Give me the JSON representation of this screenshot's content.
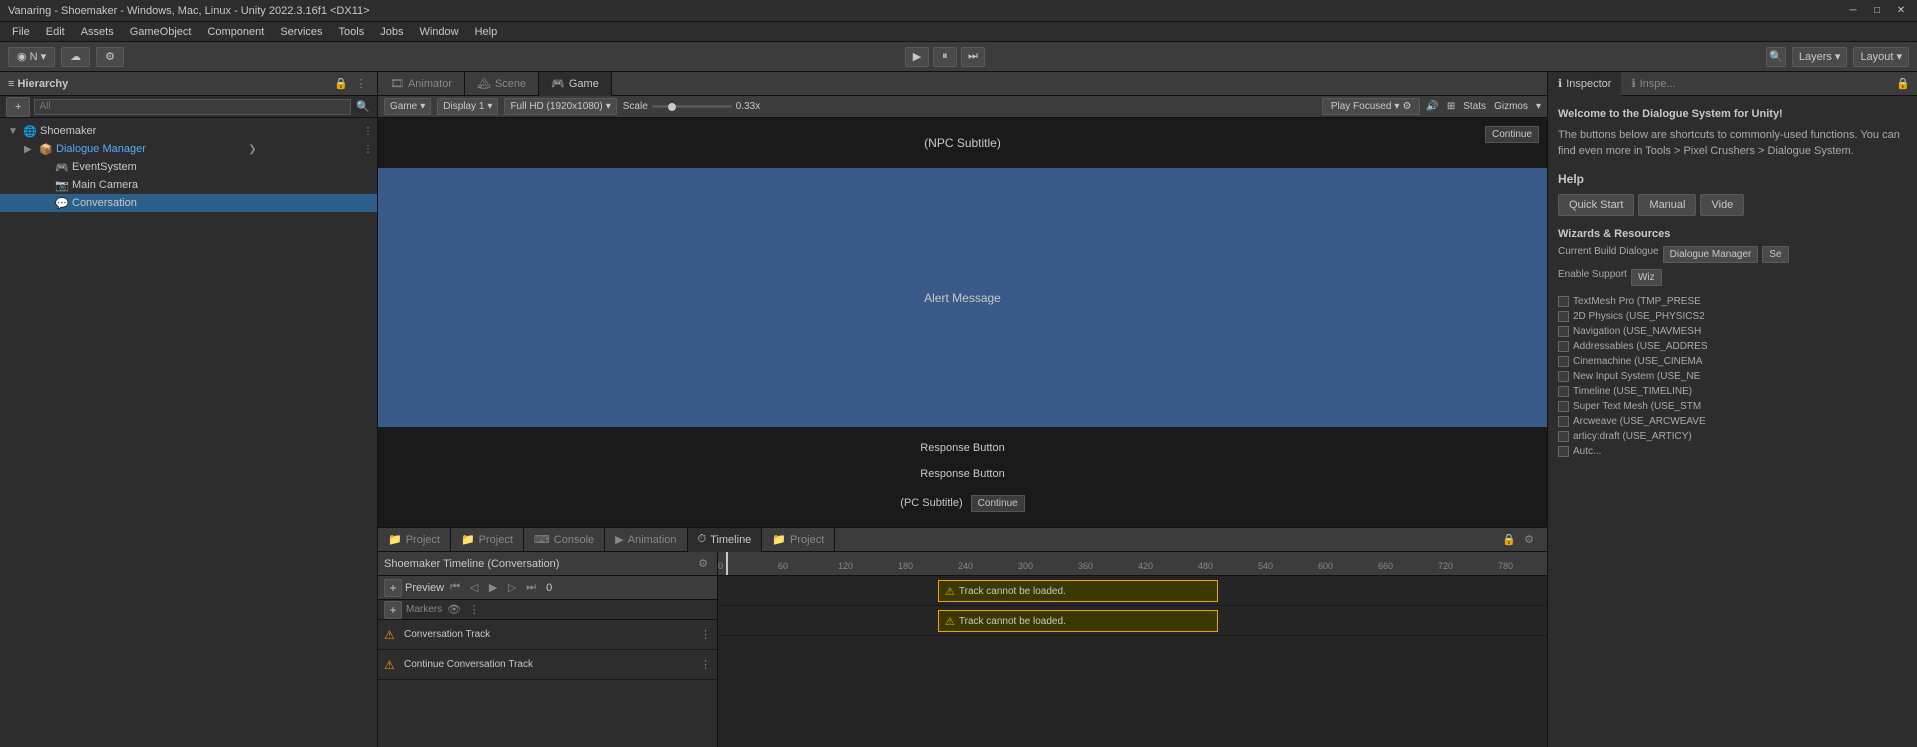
{
  "titleBar": {
    "title": "Vanaring - Shoemaker - Windows, Mac, Linux - Unity 2022.3.16f1 <DX11>",
    "minimizeIcon": "─",
    "maximizeIcon": "□",
    "closeIcon": "✕"
  },
  "menuBar": {
    "items": [
      "File",
      "Edit",
      "Assets",
      "GameObject",
      "Component",
      "Services",
      "Tools",
      "Jobs",
      "Window",
      "Help"
    ]
  },
  "toolbar": {
    "accountBtn": "◉ N ▾",
    "cloudBtn": "☁",
    "settingsBtn": "⚙",
    "playBtn": "▶",
    "pauseBtn": "⏸",
    "stepBtn": "⏭",
    "searchIcon": "🔍",
    "layersLabel": "Layers",
    "layersArrow": "▾",
    "layoutLabel": "Layout",
    "layoutArrow": "▾",
    "historyIcon": "↺"
  },
  "hierarchy": {
    "title": "Hierarchy",
    "searchPlaceholder": "All",
    "items": [
      {
        "label": "Shoemaker",
        "indent": 0,
        "expanded": true,
        "icon": "🌐",
        "type": "root"
      },
      {
        "label": "Dialogue Manager",
        "indent": 1,
        "expanded": true,
        "icon": "📦",
        "type": "component",
        "selected": false,
        "hasArrow": true
      },
      {
        "label": "EventSystem",
        "indent": 2,
        "expanded": false,
        "icon": "🎮",
        "type": "object"
      },
      {
        "label": "Main Camera",
        "indent": 2,
        "expanded": false,
        "icon": "📷",
        "type": "object"
      },
      {
        "label": "Conversation",
        "indent": 2,
        "expanded": false,
        "icon": "💬",
        "type": "object",
        "selected": true
      }
    ]
  },
  "gameView": {
    "tabs": [
      "Animator",
      "Scene",
      "Game"
    ],
    "activeTab": "Game",
    "displayDropdown": "Game",
    "displayNum": "Display 1",
    "resolution": "Full HD (1920x1080)",
    "scaleLabel": "Scale",
    "scaleValue": "0.33x",
    "playFocusedLabel": "Play Focused",
    "statsLabel": "Stats",
    "gizmosLabel": "Gizmos",
    "npcSubtitleLabel": "(NPC Subtitle)",
    "continueTopLabel": "Continue",
    "alertMessageLabel": "Alert Message",
    "responseBtn1": "Response Button",
    "responseBtn2": "Response Button",
    "pcSubtitleLabel": "(PC Subtitle)",
    "continueBottomLabel": "Continue"
  },
  "inspector": {
    "tabs": [
      "Inspector",
      "Inspector"
    ],
    "activeTab": "Inspector",
    "welcomeText": "Welcome to the Dialogue System for Unity!",
    "welcomeSubtext": "The buttons below are shortcuts to commonly-used functions. You can find even more in Tools > Pixel Crushers > Dialogue System.",
    "helpTitle": "Help",
    "helpButtons": [
      "Quick Start",
      "Manual",
      "Vide"
    ],
    "wizardsTitle": "Wizards & Resources",
    "currentBuildLabel": "Current Build Dialogue",
    "buildBtns": [
      "Dialogue Manager",
      "Se"
    ],
    "enableSupportLabel": "Enable Support",
    "enableSupportBtn": "Wiz",
    "defines": [
      {
        "label": "TextMesh Pro (TMP_PRESE",
        "checked": false
      },
      {
        "label": "2D Physics (USE_PHYSICS2",
        "checked": false
      },
      {
        "label": "Navigation (USE_NAVMESH",
        "checked": false
      },
      {
        "label": "Addressables (USE_ADDRES",
        "checked": false
      },
      {
        "label": "Cinemachine (USE_CINEMA",
        "checked": false
      },
      {
        "label": "New Input System (USE_NE",
        "checked": false
      },
      {
        "label": "Timeline (USE_TIMELINE)",
        "checked": false
      },
      {
        "label": "Super Text Mesh (USE_STM",
        "checked": false
      },
      {
        "label": "Arcweave (USE_ARCWEAVE",
        "checked": false
      },
      {
        "label": "articy:draft (USE_ARTICY)",
        "checked": false
      },
      {
        "label": "Autc...",
        "checked": false
      }
    ]
  },
  "bottomTabs": {
    "tabs": [
      "Project",
      "Project",
      "Console",
      "Animation",
      "Timeline",
      "Project"
    ],
    "activeTab": "Timeline",
    "timelineName": "Shoemaker Timeline (Conversation)",
    "previewLabel": "Preview",
    "timeDisplay": "0",
    "markersLabel": "Markers",
    "tracks": [
      {
        "label": "Conversation Track",
        "warn": true,
        "error": "Track cannot be loaded."
      },
      {
        "label": "Continue Conversation Track",
        "warn": true,
        "error": "Track cannot be loaded."
      }
    ],
    "rulerMarks": [
      "0",
      "60",
      "120",
      "180",
      "240",
      "300",
      "360",
      "420",
      "480",
      "540",
      "600",
      "660",
      "720",
      "780"
    ]
  }
}
